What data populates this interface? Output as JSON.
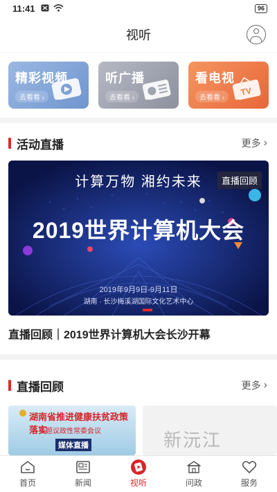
{
  "status_bar": {
    "time": "11:41",
    "battery": "96"
  },
  "header": {
    "title": "视听"
  },
  "categories": [
    {
      "label": "精彩视频",
      "sub": "去看看 ›",
      "color": "#7fa3d8"
    },
    {
      "label": "听广播",
      "sub": "去看看 ›",
      "color": "#a0a4b0"
    },
    {
      "label": "看电视",
      "sub": "去看看 ›",
      "color": "#ee7a45"
    }
  ],
  "live_section": {
    "title": "活动直播",
    "more": "更多",
    "banner": {
      "badge": "直播回顾",
      "slogan": "计算万物  湘约未来",
      "main_title": "2019世界计算机大会",
      "date": "2019年9月9日-9月11日",
      "venue": "湖南 · 长沙梅溪湖国际文化艺术中心"
    },
    "caption": "直播回顾｜2019世界计算机大会长沙开幕"
  },
  "replay_section": {
    "title": "直播回顾",
    "more": "更多",
    "items": [
      {
        "title": "湖南省推进健康扶贫政策落实",
        "subtitle": "专题议政性常委会议",
        "tag": "媒体直播"
      },
      {
        "logo": "新沅江"
      }
    ]
  },
  "tabbar": [
    {
      "label": "首页",
      "icon": "home-icon",
      "active": false
    },
    {
      "label": "新闻",
      "icon": "news-icon",
      "active": false
    },
    {
      "label": "视听",
      "icon": "play-icon",
      "active": true
    },
    {
      "label": "问政",
      "icon": "government-icon",
      "active": false
    },
    {
      "label": "服务",
      "icon": "heart-icon",
      "active": false
    }
  ],
  "colors": {
    "accent": "#d8242a",
    "banner_bg": "#0f1a55"
  }
}
